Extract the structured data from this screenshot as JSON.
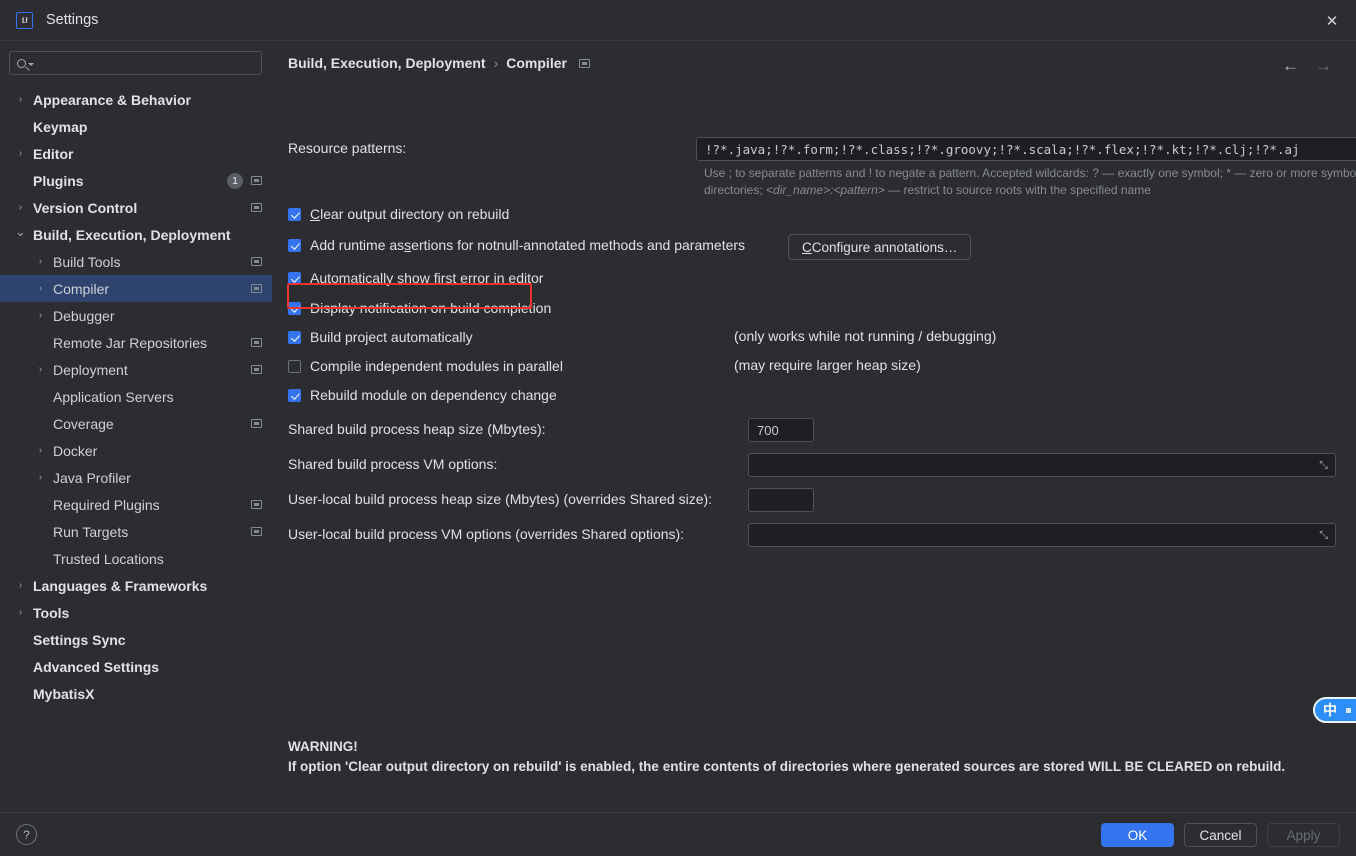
{
  "window": {
    "title": "Settings",
    "logo_text": "IJ",
    "close_icon": "close-icon"
  },
  "sidebar": {
    "search": {
      "placeholder": "",
      "value": ""
    },
    "items": [
      {
        "label": "Appearance & Behavior",
        "level": 0,
        "arrow": "›",
        "bold": true,
        "page_icon": false,
        "badge": null,
        "selected": false
      },
      {
        "label": "Keymap",
        "level": 0,
        "arrow": "",
        "bold": true,
        "page_icon": false,
        "badge": null,
        "selected": false
      },
      {
        "label": "Editor",
        "level": 0,
        "arrow": "›",
        "bold": true,
        "page_icon": false,
        "badge": null,
        "selected": false
      },
      {
        "label": "Plugins",
        "level": 0,
        "arrow": "",
        "bold": true,
        "page_icon": true,
        "badge": "1",
        "selected": false
      },
      {
        "label": "Version Control",
        "level": 0,
        "arrow": "›",
        "bold": true,
        "page_icon": true,
        "badge": null,
        "selected": false
      },
      {
        "label": "Build, Execution, Deployment",
        "level": 0,
        "arrow": "⌄",
        "bold": true,
        "page_icon": false,
        "badge": null,
        "selected": false
      },
      {
        "label": "Build Tools",
        "level": 1,
        "arrow": "›",
        "bold": false,
        "page_icon": true,
        "badge": null,
        "selected": false
      },
      {
        "label": "Compiler",
        "level": 1,
        "arrow": "›",
        "bold": false,
        "page_icon": true,
        "badge": null,
        "selected": true
      },
      {
        "label": "Debugger",
        "level": 1,
        "arrow": "›",
        "bold": false,
        "page_icon": false,
        "badge": null,
        "selected": false
      },
      {
        "label": "Remote Jar Repositories",
        "level": 1,
        "arrow": "",
        "bold": false,
        "page_icon": true,
        "badge": null,
        "selected": false
      },
      {
        "label": "Deployment",
        "level": 1,
        "arrow": "›",
        "bold": false,
        "page_icon": true,
        "badge": null,
        "selected": false
      },
      {
        "label": "Application Servers",
        "level": 1,
        "arrow": "",
        "bold": false,
        "page_icon": false,
        "badge": null,
        "selected": false
      },
      {
        "label": "Coverage",
        "level": 1,
        "arrow": "",
        "bold": false,
        "page_icon": true,
        "badge": null,
        "selected": false
      },
      {
        "label": "Docker",
        "level": 1,
        "arrow": "›",
        "bold": false,
        "page_icon": false,
        "badge": null,
        "selected": false
      },
      {
        "label": "Java Profiler",
        "level": 1,
        "arrow": "›",
        "bold": false,
        "page_icon": false,
        "badge": null,
        "selected": false
      },
      {
        "label": "Required Plugins",
        "level": 1,
        "arrow": "",
        "bold": false,
        "page_icon": true,
        "badge": null,
        "selected": false
      },
      {
        "label": "Run Targets",
        "level": 1,
        "arrow": "",
        "bold": false,
        "page_icon": true,
        "badge": null,
        "selected": false
      },
      {
        "label": "Trusted Locations",
        "level": 1,
        "arrow": "",
        "bold": false,
        "page_icon": false,
        "badge": null,
        "selected": false
      },
      {
        "label": "Languages & Frameworks",
        "level": 0,
        "arrow": "›",
        "bold": true,
        "page_icon": false,
        "badge": null,
        "selected": false
      },
      {
        "label": "Tools",
        "level": 0,
        "arrow": "›",
        "bold": true,
        "page_icon": false,
        "badge": null,
        "selected": false
      },
      {
        "label": "Settings Sync",
        "level": 0,
        "arrow": "",
        "bold": true,
        "page_icon": false,
        "badge": null,
        "selected": false
      },
      {
        "label": "Advanced Settings",
        "level": 0,
        "arrow": "",
        "bold": true,
        "page_icon": false,
        "badge": null,
        "selected": false
      },
      {
        "label": "MybatisX",
        "level": 0,
        "arrow": "",
        "bold": true,
        "page_icon": false,
        "badge": null,
        "selected": false
      }
    ]
  },
  "breadcrumb": {
    "root": "Build, Execution, Deployment",
    "separator": "›",
    "current": "Compiler",
    "page_icon": "settings-page-icon"
  },
  "nav": {
    "back_icon": "←",
    "forward_icon": "→"
  },
  "form": {
    "resource_patterns": {
      "label": "Resource patterns:",
      "value": "!?*.java;!?*.form;!?*.class;!?*.groovy;!?*.scala;!?*.flex;!?*.kt;!?*.clj;!?*.aj",
      "expand_icon": "⤡"
    },
    "hint_line1_a": "Use ; to separate patterns and ! to negate a pattern. Accepted wildcards: ? — exactly one symbol; * — zero or more symbols; / — path separator; /**/ — any number of directories; ",
    "hint_italic": "<dir_name>:<pattern>",
    "hint_line1_b": " — restrict to source roots with the specified name",
    "checkboxes": [
      {
        "label_pre": "C",
        "label_mn": "",
        "label_post": "lear output directory on rebuild",
        "full": "Clear output directory on rebuild",
        "mn_index": 0,
        "checked": true
      },
      {
        "full": "Add runtime assertions for notnull-annotated methods and parameters",
        "mn_index": 14,
        "checked": true
      },
      {
        "full": "Automatically show first error in editor",
        "mn_index": 31,
        "checked": true
      },
      {
        "full": "Display notification on build completion",
        "mn_index": -1,
        "checked": true
      },
      {
        "full": "Build project automatically",
        "mn_index": -1,
        "checked": true
      },
      {
        "full": "Compile independent modules in parallel",
        "mn_index": -1,
        "checked": false
      },
      {
        "full": "Rebuild module on dependency change",
        "mn_index": -1,
        "checked": true
      }
    ],
    "configure_annotations_button": "Configure annotations…",
    "hint_running": "(only works while not running / debugging)",
    "hint_heap": "(may require larger heap size)",
    "fields": [
      {
        "label": "Shared build process heap size (Mbytes):",
        "value": "700",
        "wide": false,
        "expand": false
      },
      {
        "label": "Shared build process VM options:",
        "value": "",
        "wide": true,
        "expand": true
      },
      {
        "label": "User-local build process heap size (Mbytes) (overrides Shared size):",
        "value": "",
        "wide": false,
        "expand": false
      },
      {
        "label": "User-local build process VM options (overrides Shared options):",
        "value": "",
        "wide": true,
        "expand": true
      }
    ]
  },
  "warning": {
    "title": "WARNING!",
    "body": "If option 'Clear output directory on rebuild' is enabled, the entire contents of directories where generated sources are stored WILL BE CLEARED on rebuild."
  },
  "footer": {
    "help_icon": "?",
    "ok": "OK",
    "cancel": "Cancel",
    "apply": "Apply"
  },
  "ime_badge": {
    "char": "中"
  },
  "colors": {
    "accent": "#3574F0",
    "selection": "#2E436E",
    "background": "#2B2D30",
    "field_background": "#1E1F22",
    "annotation": "#E8332E"
  }
}
